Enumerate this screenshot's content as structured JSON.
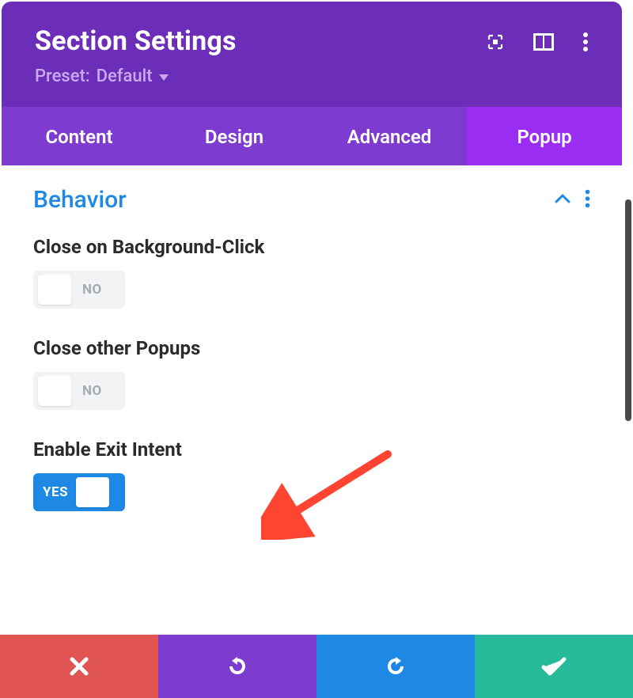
{
  "header": {
    "title": "Section Settings",
    "preset_label": "Preset:",
    "preset_value": "Default"
  },
  "tabs": {
    "content": "Content",
    "design": "Design",
    "advanced": "Advanced",
    "popup": "Popup",
    "active": "popup"
  },
  "section": {
    "title": "Behavior"
  },
  "fields": {
    "close_bg": {
      "label": "Close on Background-Click",
      "value": "NO"
    },
    "close_other": {
      "label": "Close other Popups",
      "value": "NO"
    },
    "exit_intent": {
      "label": "Enable Exit Intent",
      "value": "YES"
    }
  },
  "footer": {
    "cancel": "cancel",
    "undo": "undo",
    "redo": "redo",
    "save": "save"
  },
  "annotation": {
    "arrow_color": "#FF4431"
  }
}
